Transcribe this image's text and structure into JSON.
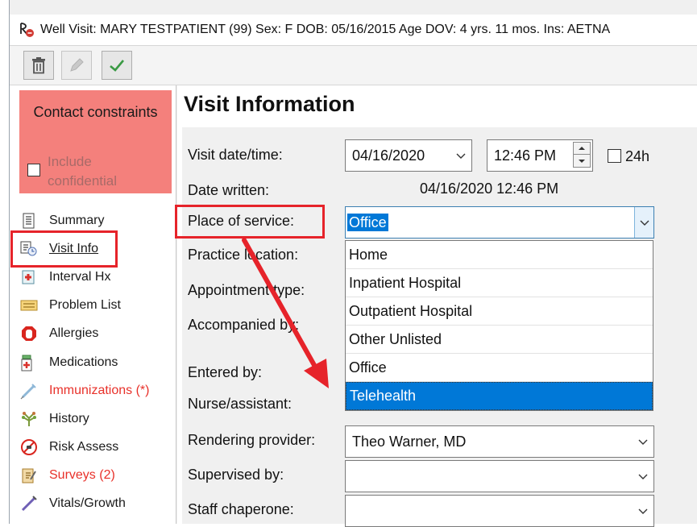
{
  "titlebar": {
    "text": "Well Visit: MARY TESTPATIENT (99)  Sex: F  DOB: 05/16/2015  Age DOV: 4 yrs. 11 mos.  Ins: AETNA"
  },
  "toolbar": {
    "delete_icon": "trash-icon",
    "edit_icon": "pencil-icon",
    "confirm_icon": "checkmark-icon"
  },
  "sidebar": {
    "contact_title": "Contact constraints",
    "include_confidential": "Include confidential",
    "items": [
      {
        "label": "Summary",
        "icon": "summary-icon"
      },
      {
        "label": "Visit Info",
        "icon": "visit-info-icon"
      },
      {
        "label": "Interval Hx",
        "icon": "interval-hx-icon"
      },
      {
        "label": "Problem List",
        "icon": "problem-list-icon"
      },
      {
        "label": "Allergies",
        "icon": "allergies-icon"
      },
      {
        "label": "Medications",
        "icon": "medications-icon"
      },
      {
        "label": "Immunizations (*)",
        "icon": "syringe-icon"
      },
      {
        "label": "History",
        "icon": "history-icon"
      },
      {
        "label": "Risk Assess",
        "icon": "risk-assess-icon"
      },
      {
        "label": "Surveys (2)",
        "icon": "surveys-icon"
      },
      {
        "label": "Vitals/Growth",
        "icon": "vitals-icon"
      }
    ]
  },
  "main": {
    "title": "Visit Information",
    "labels": {
      "visit_datetime": "Visit date/time:",
      "date_written": "Date written:",
      "place_of_service": "Place of service:",
      "practice_location": "Practice location:",
      "appointment_type": "Appointment type:",
      "accompanied_by": "Accompanied by:",
      "entered_by": "Entered by:",
      "nurse_assistant": "Nurse/assistant:",
      "rendering_provider": "Rendering provider:",
      "supervised_by": "Supervised by:",
      "staff_chaperone": "Staff chaperone:"
    },
    "visit_date": "04/16/2020",
    "visit_time": "12:46 PM",
    "h24_label": "24h",
    "date_written_value": "04/16/2020 12:46 PM",
    "place_of_service_value": "Office",
    "place_options": [
      "Home",
      "Inpatient Hospital",
      "Outpatient Hospital",
      "Other Unlisted",
      "Office",
      "Telehealth"
    ],
    "rendering_provider_value": "Theo Warner, MD",
    "supervised_by_value": "",
    "staff_chaperone_value": ""
  },
  "colors": {
    "contact_box": "#f4807c",
    "highlight": "#e6232a",
    "selection": "#0078d7",
    "red_text": "#e8312a"
  }
}
